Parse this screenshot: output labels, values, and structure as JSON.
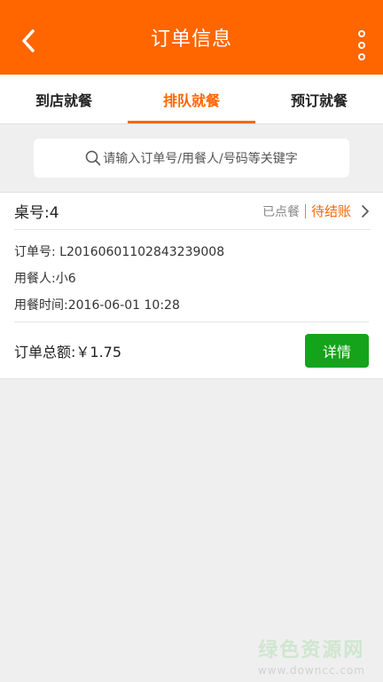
{
  "header": {
    "title": "订单信息",
    "back_icon": "chevron-left-icon",
    "more_icon": "more-vertical-icon",
    "accent_color": "#ff6600"
  },
  "tabs": [
    {
      "label": "到店就餐",
      "active": false
    },
    {
      "label": "排队就餐",
      "active": true
    },
    {
      "label": "预订就餐",
      "active": false
    }
  ],
  "search": {
    "placeholder": "请输入订单号/用餐人/号码等关键字",
    "icon": "search-icon"
  },
  "order": {
    "table_label": "桌号:4",
    "status_ordered": "已点餐",
    "status_pending": "待结账",
    "order_no": "订单号:  L20160601102843239008",
    "diner": "用餐人:小6",
    "dining_time": "用餐时间:2016-06-01 10:28",
    "total": "订单总额:￥1.75",
    "detail_label": "详情",
    "detail_color": "#15a31c"
  },
  "watermark": {
    "title": "绿色资源网",
    "url": "www.downcc.com"
  }
}
